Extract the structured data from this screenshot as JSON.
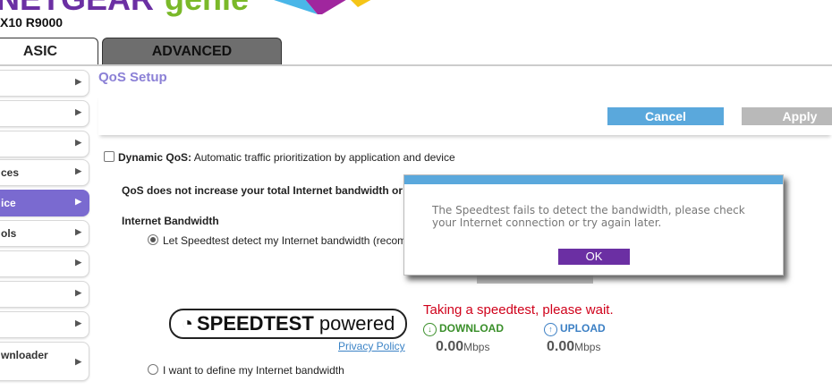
{
  "header": {
    "brand_netgear": "NETGEAR",
    "brand_genie": "genie",
    "model": "X10 R9000"
  },
  "tabs": [
    {
      "label": "ASIC"
    },
    {
      "label": "ADVANCED"
    }
  ],
  "sidebar": {
    "items": [
      {
        "label": ""
      },
      {
        "label": ""
      },
      {
        "label": ""
      },
      {
        "label": "ces"
      },
      {
        "label": "ice"
      },
      {
        "label": "ols"
      },
      {
        "label": ""
      },
      {
        "label": ""
      },
      {
        "label": ""
      },
      {
        "label": "wnloader"
      }
    ]
  },
  "main": {
    "title": "QoS Setup",
    "cancel_label": "Cancel",
    "apply_label": "Apply",
    "dynamic_qos_label": "Dynamic QoS:",
    "dynamic_qos_desc": "Automatic traffic prioritization by application and device",
    "note": "QoS does not increase your total Internet bandwidth or",
    "bandwidth_heading": "Internet Bandwidth",
    "radio_speedtest": "Let Speedtest detect my Internet bandwidth (recom",
    "radio_manual": "I want to define my Internet bandwidth",
    "speedtest_logo_bold": "SPEEDTEST",
    "speedtest_logo_rest": "powered",
    "privacy_policy": "Privacy Policy",
    "taking_msg": "Taking a speedtest, please wait.",
    "download_label": "DOWNLOAD",
    "upload_label": "UPLOAD",
    "download_value": "0.00",
    "upload_value": "0.00",
    "unit": "Mbps"
  },
  "modal": {
    "message": "The Speedtest fails to detect the bandwidth, please check your Internet connection or try again later.",
    "ok_label": "OK"
  },
  "colors": {
    "netgear_purple": "#6b2fa3",
    "genie_green": "#7ab929",
    "accent_blue": "#5aa8dc",
    "active_side": "#7a6ad0",
    "error_red": "#d0021b"
  }
}
